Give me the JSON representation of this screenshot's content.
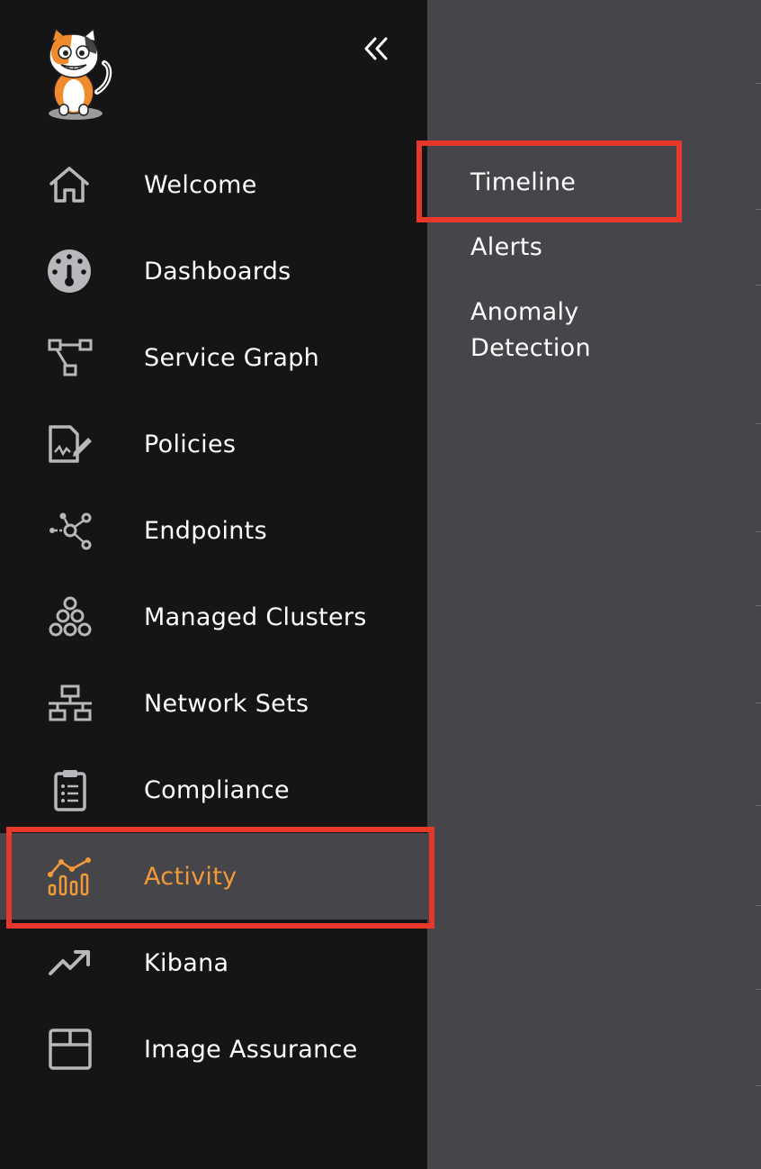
{
  "sidebar": {
    "logo_icon": "cat-mascot-logo",
    "collapse_icon": "double-chevron-left-icon",
    "items": [
      {
        "label": "Welcome",
        "icon": "home-icon"
      },
      {
        "label": "Dashboards",
        "icon": "gauge-icon"
      },
      {
        "label": "Service Graph",
        "icon": "graph-nodes-icon"
      },
      {
        "label": "Policies",
        "icon": "document-edit-icon"
      },
      {
        "label": "Endpoints",
        "icon": "network-endpoints-icon"
      },
      {
        "label": "Managed Clusters",
        "icon": "clusters-icon"
      },
      {
        "label": "Network Sets",
        "icon": "network-tree-icon"
      },
      {
        "label": "Compliance",
        "icon": "clipboard-list-icon"
      },
      {
        "label": "Activity",
        "icon": "activity-chart-icon",
        "active": true
      },
      {
        "label": "Kibana",
        "icon": "trend-up-icon"
      },
      {
        "label": "Image Assurance",
        "icon": "box-icon"
      }
    ]
  },
  "submenu": {
    "items": [
      {
        "label": "Timeline",
        "highlighted": true
      },
      {
        "label": "Alerts"
      },
      {
        "label": "Anomaly\nDetection"
      }
    ]
  },
  "colors": {
    "sidebar_bg": "#151515",
    "panel_bg": "#46464a",
    "active_accent": "#f19a37",
    "highlight_border": "#e8382b",
    "icon_gray": "#b8b8bc"
  }
}
